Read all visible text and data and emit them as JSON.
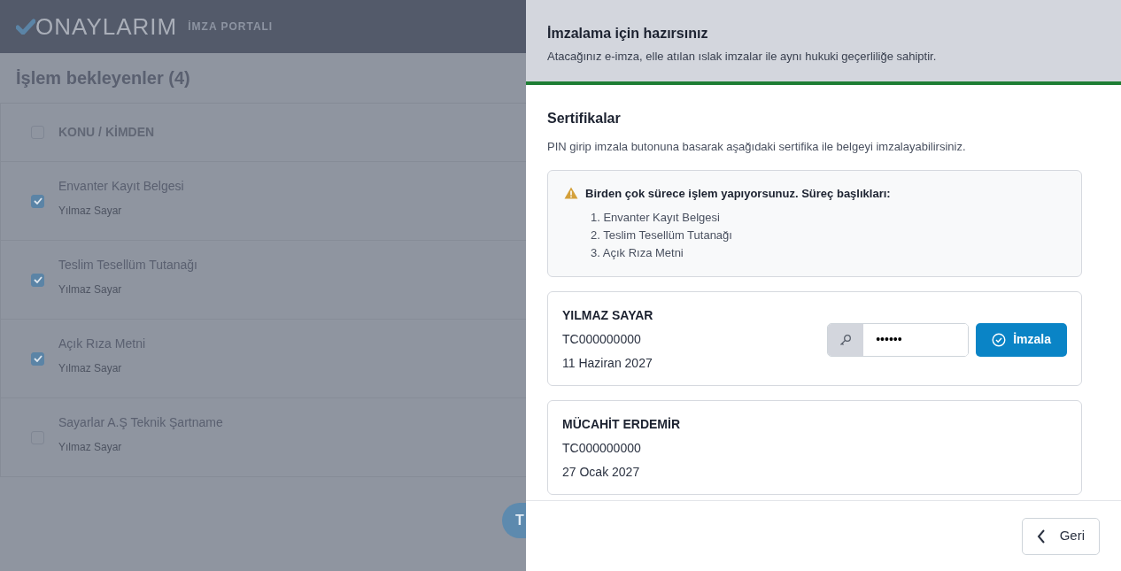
{
  "app": {
    "logo_text": "ONAYLARIM",
    "logo_subtitle": "İMZA PORTALI",
    "page_title": "İşlem bekleyenler (4)",
    "list_header": {
      "label": "KONU / KİMDEN",
      "checked": false
    },
    "items": [
      {
        "subject": "Envanter Kayıt Belgesi",
        "sender": "Yılmaz Sayar",
        "checked": true
      },
      {
        "subject": "Teslim Tesellüm Tutanağı",
        "sender": "Yılmaz Sayar",
        "checked": true
      },
      {
        "subject": "Açık Rıza Metni",
        "sender": "Yılmaz Sayar",
        "checked": true
      },
      {
        "subject": "Sayarlar A.Ş Teknik Şartname",
        "sender": "Yılmaz Sayar",
        "checked": false
      }
    ],
    "partial_button": "T"
  },
  "panel": {
    "title": "İmzalama için hazırsınız",
    "subtitle": "Atacağınız e-imza, elle atılan ıslak imzalar ile aynı hukuki geçerliliğe sahiptir.",
    "section_title": "Sertifikalar",
    "section_description": "PIN girip imzala butonuna basarak aşağıdaki sertifika ile belgeyi imzalayabilirsiniz.",
    "warning": {
      "title": "Birden çok sürece işlem yapıyorsunuz. Süreç başlıkları:",
      "items": [
        "1. Envanter Kayıt Belgesi",
        "2. Teslim Tesellüm Tutanağı",
        "3. Açık Rıza Metni"
      ]
    },
    "certificates": [
      {
        "name": "YILMAZ SAYAR",
        "id": "TC000000000",
        "date": "11 Haziran 2027",
        "pin": {
          "value": "••••••"
        },
        "sign_button": "İmzala"
      },
      {
        "name": "MÜCAHİT ERDEMİR",
        "id": "TC000000000",
        "date": "27 Ocak 2027"
      }
    ],
    "back_button": "Geri"
  }
}
